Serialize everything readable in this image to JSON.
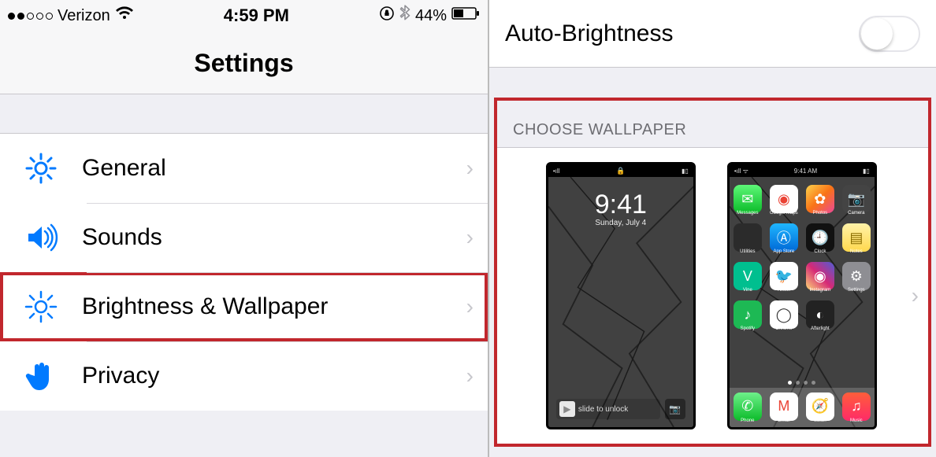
{
  "statusbar": {
    "carrier": "Verizon",
    "time": "4:59 PM",
    "battery_pct": "44%"
  },
  "header": {
    "title": "Settings"
  },
  "settings_rows": [
    {
      "id": "general",
      "label": "General"
    },
    {
      "id": "sounds",
      "label": "Sounds"
    },
    {
      "id": "brightness-wallpaper",
      "label": "Brightness & Wallpaper"
    },
    {
      "id": "privacy",
      "label": "Privacy"
    }
  ],
  "right": {
    "auto_brightness_label": "Auto-Brightness",
    "choose_wallpaper_label": "CHOOSE WALLPAPER",
    "lock_preview": {
      "time": "9:41",
      "date": "Sunday, July 4",
      "slide_text": "slide to unlock"
    },
    "home_preview": {
      "time": "9:41 AM",
      "apps_row1": [
        "Messages",
        "Google Maps",
        "Photos",
        "Camera"
      ],
      "apps_row2": [
        "Utilities",
        "App Store",
        "Clock",
        "Notes"
      ],
      "apps_row3": [
        "Vine",
        "Twitter",
        "Instagram",
        "Settings"
      ],
      "apps_row4": [
        "Spotify",
        "Chrome",
        "Afterlight",
        ""
      ],
      "dock": [
        "Phone",
        "Gmail",
        "Safari",
        "Music"
      ]
    }
  }
}
